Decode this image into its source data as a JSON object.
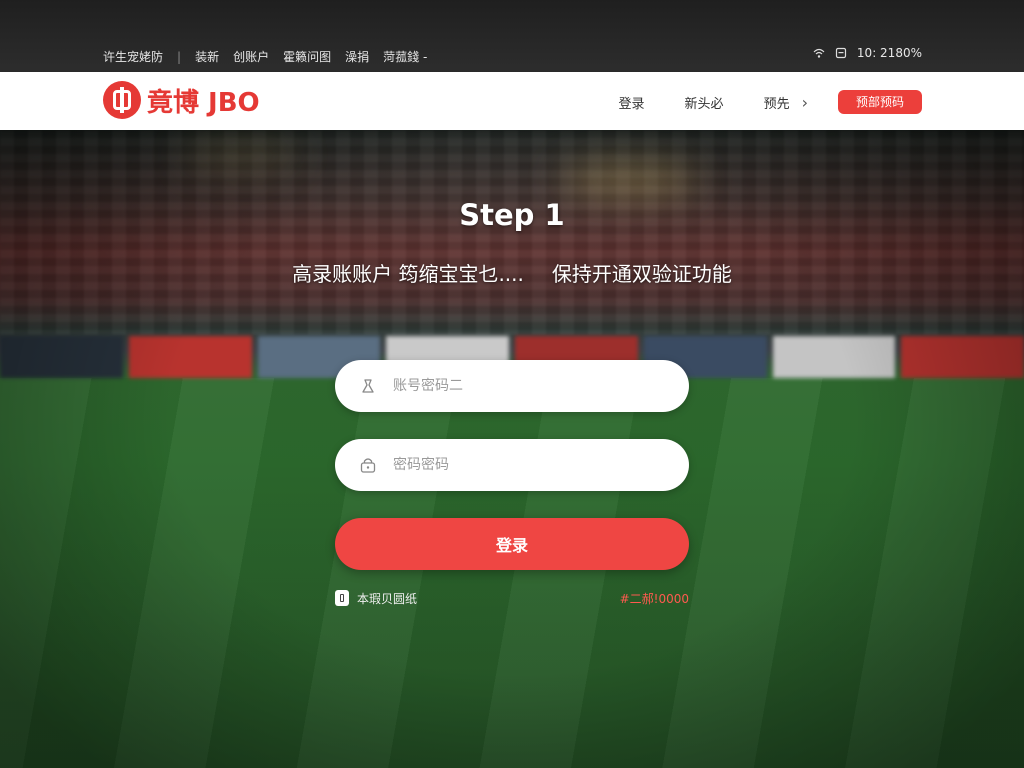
{
  "statusbar": {
    "links": [
      "许生宠姥防",
      "装新",
      "创账户",
      "霍籁问图",
      "澡捐",
      "菏菰錢 -"
    ],
    "right_text": "10: 2180%",
    "icons": [
      "wifi-icon",
      "battery-icon"
    ]
  },
  "header": {
    "logo_text": "竟博 JBO",
    "nav": {
      "items": [
        "登录",
        "新头必",
        "预先"
      ],
      "cta_label": "预部预码"
    }
  },
  "main": {
    "step_title": "Step 1",
    "subtitle_part1": "高录账账户 筠缩宝宝乜....",
    "subtitle_part2": "保持开通双验证功能",
    "account_field": {
      "placeholder": "账号密码二",
      "icon": "user-icon"
    },
    "password_field": {
      "placeholder": "密码密码",
      "icon": "lock-icon"
    },
    "login_label": "登录",
    "remember_label": "本瑕贝圆纸",
    "forgot_label": "#二郝!0000"
  },
  "colors": {
    "brand_red": "#e53935",
    "button_red": "#ef4643",
    "status_bar_bg": "#2d2d2d"
  }
}
